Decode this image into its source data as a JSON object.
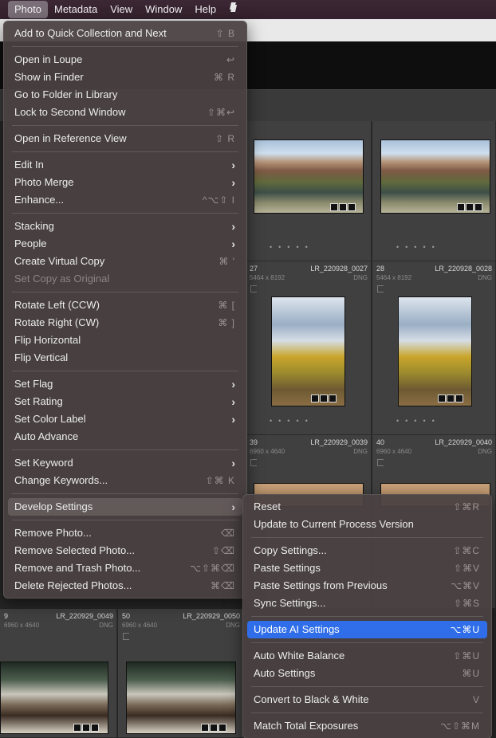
{
  "menubar": {
    "items": [
      "Photo",
      "Metadata",
      "View",
      "Window",
      "Help"
    ],
    "extra_icon": "script-icon"
  },
  "grid": {
    "cells": [
      {
        "num": "27",
        "name": "LR_220928_0027",
        "dims": "5464 x 8192",
        "ext": "DNG"
      },
      {
        "num": "28",
        "name": "LR_220928_0028",
        "dims": "5464 x 8192",
        "ext": "DNG"
      },
      {
        "num": "39",
        "name": "LR_220929_0039",
        "dims": "6960 x 4640",
        "ext": "DNG"
      },
      {
        "num": "40",
        "name": "LR_220929_0040",
        "dims": "6960 x 4640",
        "ext": "DNG"
      },
      {
        "num": "9",
        "name": "LR_220929_0049",
        "dims": "6960 x 4640",
        "ext": "DNG"
      },
      {
        "num": "50",
        "name": "LR_220929_0050",
        "dims": "6960 x 4640",
        "ext": "DNG"
      }
    ]
  },
  "photo_menu": {
    "items": [
      {
        "label": "Add to Quick Collection and Next",
        "shortcut": "⇧ B"
      },
      {
        "label": "Open in Loupe",
        "shortcut": "↩"
      },
      {
        "label": "Show in Finder",
        "shortcut": "⌘ R"
      },
      {
        "label": "Go to Folder in Library",
        "shortcut": ""
      },
      {
        "label": "Lock to Second Window",
        "shortcut": "⇧⌘↩"
      },
      {
        "label": "Open in Reference View",
        "shortcut": "⇧ R"
      },
      {
        "label": "Edit In",
        "shortcut": ""
      },
      {
        "label": "Photo Merge",
        "shortcut": ""
      },
      {
        "label": "Enhance...",
        "shortcut": "^⌥⇧ I"
      },
      {
        "label": "Stacking",
        "shortcut": ""
      },
      {
        "label": "People",
        "shortcut": ""
      },
      {
        "label": "Create Virtual Copy",
        "shortcut": "⌘ '"
      },
      {
        "label": "Set Copy as Original",
        "shortcut": ""
      },
      {
        "label": "Rotate Left (CCW)",
        "shortcut": "⌘ ["
      },
      {
        "label": "Rotate Right (CW)",
        "shortcut": "⌘ ]"
      },
      {
        "label": "Flip Horizontal",
        "shortcut": ""
      },
      {
        "label": "Flip Vertical",
        "shortcut": ""
      },
      {
        "label": "Set Flag",
        "shortcut": ""
      },
      {
        "label": "Set Rating",
        "shortcut": ""
      },
      {
        "label": "Set Color Label",
        "shortcut": ""
      },
      {
        "label": "Auto Advance",
        "shortcut": ""
      },
      {
        "label": "Set Keyword",
        "shortcut": ""
      },
      {
        "label": "Change Keywords...",
        "shortcut": "⇧⌘ K"
      },
      {
        "label": "Develop Settings",
        "shortcut": ""
      },
      {
        "label": "Remove Photo...",
        "shortcut": "⌫"
      },
      {
        "label": "Remove Selected Photo...",
        "shortcut": "⇧⌫"
      },
      {
        "label": "Remove and Trash Photo...",
        "shortcut": "⌥⇧⌘⌫"
      },
      {
        "label": "Delete Rejected Photos...",
        "shortcut": "⌘⌫"
      }
    ]
  },
  "develop_submenu": {
    "items": [
      {
        "label": "Reset",
        "shortcut": "⇧⌘R"
      },
      {
        "label": "Update to Current Process Version",
        "shortcut": ""
      },
      {
        "label": "Copy Settings...",
        "shortcut": "⇧⌘C"
      },
      {
        "label": "Paste Settings",
        "shortcut": "⇧⌘V"
      },
      {
        "label": "Paste Settings from Previous",
        "shortcut": "⌥⌘V"
      },
      {
        "label": "Sync Settings...",
        "shortcut": "⇧⌘S"
      },
      {
        "label": "Update AI Settings",
        "shortcut": "⌥⌘U"
      },
      {
        "label": "Auto White Balance",
        "shortcut": "⇧⌘U"
      },
      {
        "label": "Auto Settings",
        "shortcut": "⌘U"
      },
      {
        "label": "Convert to Black & White",
        "shortcut": "V"
      },
      {
        "label": "Match Total Exposures",
        "shortcut": "⌥⇧⌘M"
      }
    ]
  }
}
